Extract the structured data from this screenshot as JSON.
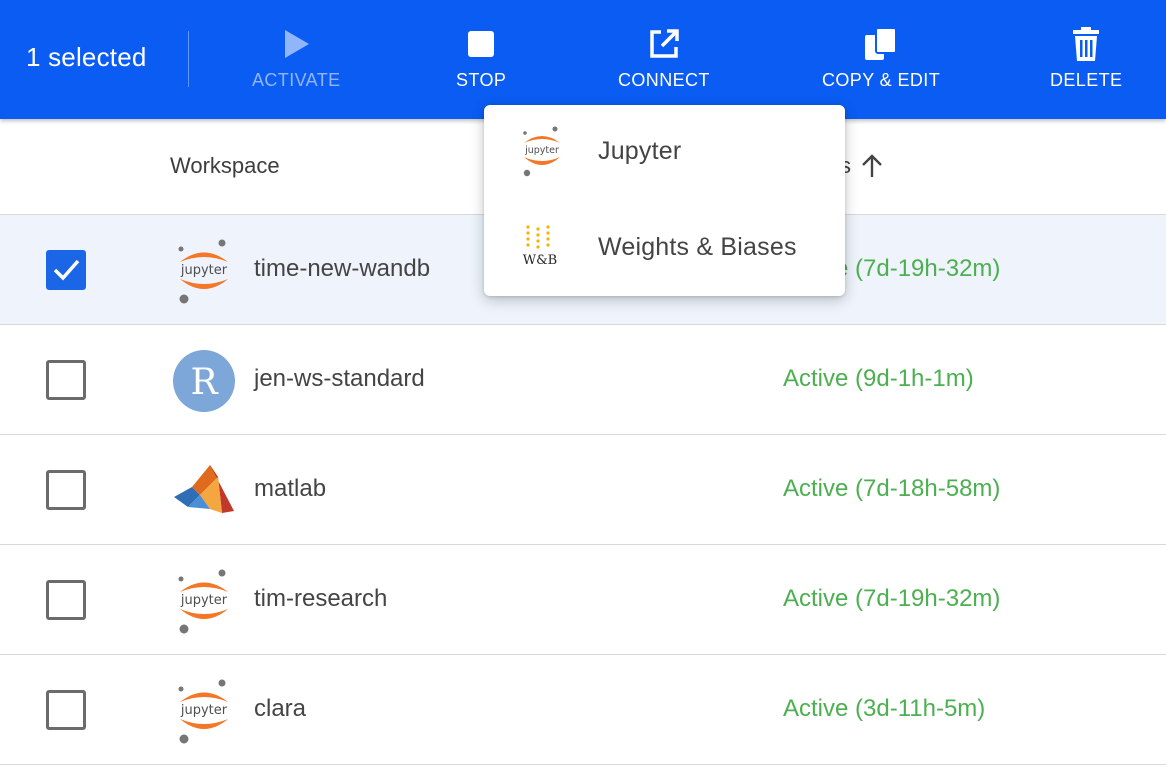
{
  "toolbar": {
    "selected_text": "1 selected",
    "activate_label": "ACTIVATE",
    "stop_label": "STOP",
    "connect_label": "CONNECT",
    "copy_edit_label": "COPY & EDIT",
    "delete_label": "DELETE",
    "bg_color": "#0a5cf2"
  },
  "table": {
    "col_workspace": "Workspace",
    "col_status": "s",
    "sort_icon": "arrow-up-icon",
    "rows": [
      {
        "name": "time-new-wandb",
        "status": "Active (7d-19h-32m)",
        "icon": "jupyter-icon",
        "checked": true
      },
      {
        "name": "jen-ws-standard",
        "status": "Active (9d-1h-1m)",
        "icon": "r-icon",
        "checked": false
      },
      {
        "name": "matlab",
        "status": "Active (7d-18h-58m)",
        "icon": "matlab-icon",
        "checked": false
      },
      {
        "name": "tim-research",
        "status": "Active (7d-19h-32m)",
        "icon": "jupyter-icon",
        "checked": false
      },
      {
        "name": "clara",
        "status": "Active (3d-11h-5m)",
        "icon": "jupyter-icon",
        "checked": false
      }
    ],
    "status_color": "#4caf50"
  },
  "connect_menu": {
    "items": [
      {
        "label": "Jupyter",
        "icon": "jupyter-icon"
      },
      {
        "label": "Weights & Biases",
        "icon": "wandb-icon",
        "icon_text": "W&B"
      }
    ]
  },
  "icons": {
    "jupyter_text": "jupyter",
    "r_text": "R"
  }
}
